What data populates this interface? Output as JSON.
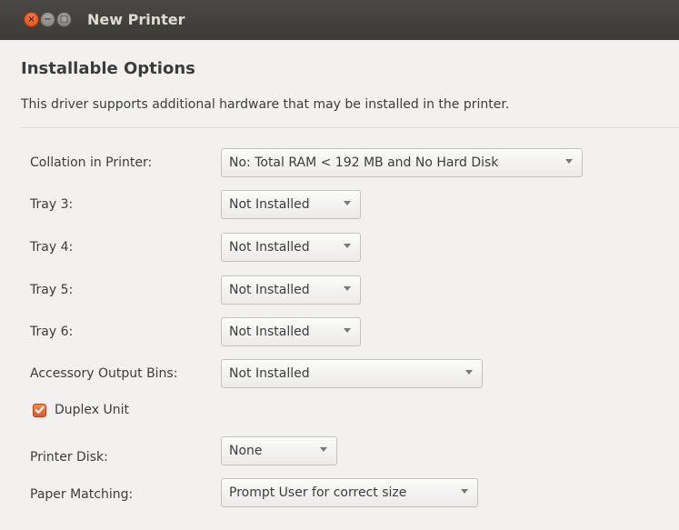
{
  "window": {
    "title": "New Printer",
    "controls": {
      "close": "×",
      "minimize": "−",
      "maximize": "□"
    }
  },
  "header": {
    "title": "Installable Options",
    "description": "This driver supports additional hardware that may be installed in the printer."
  },
  "options": [
    {
      "label": "Collation in Printer:",
      "value": "No: Total RAM < 192 MB and No Hard Disk"
    },
    {
      "label": "Tray 3:",
      "value": "Not Installed"
    },
    {
      "label": "Tray 4:",
      "value": "Not Installed"
    },
    {
      "label": "Tray 5:",
      "value": "Not Installed"
    },
    {
      "label": "Tray 6:",
      "value": "Not Installed"
    },
    {
      "label": "Accessory Output Bins:",
      "value": "Not Installed"
    }
  ],
  "duplex": {
    "label": "Duplex Unit",
    "checked": true
  },
  "options2": [
    {
      "label": "Printer Disk:",
      "value": "None"
    },
    {
      "label": "Paper Matching:",
      "value": "Prompt User for correct size"
    }
  ],
  "colors": {
    "titlebar": "#3b3a36",
    "window_bg": "#f2f1f0",
    "accent": "#dd4814"
  }
}
